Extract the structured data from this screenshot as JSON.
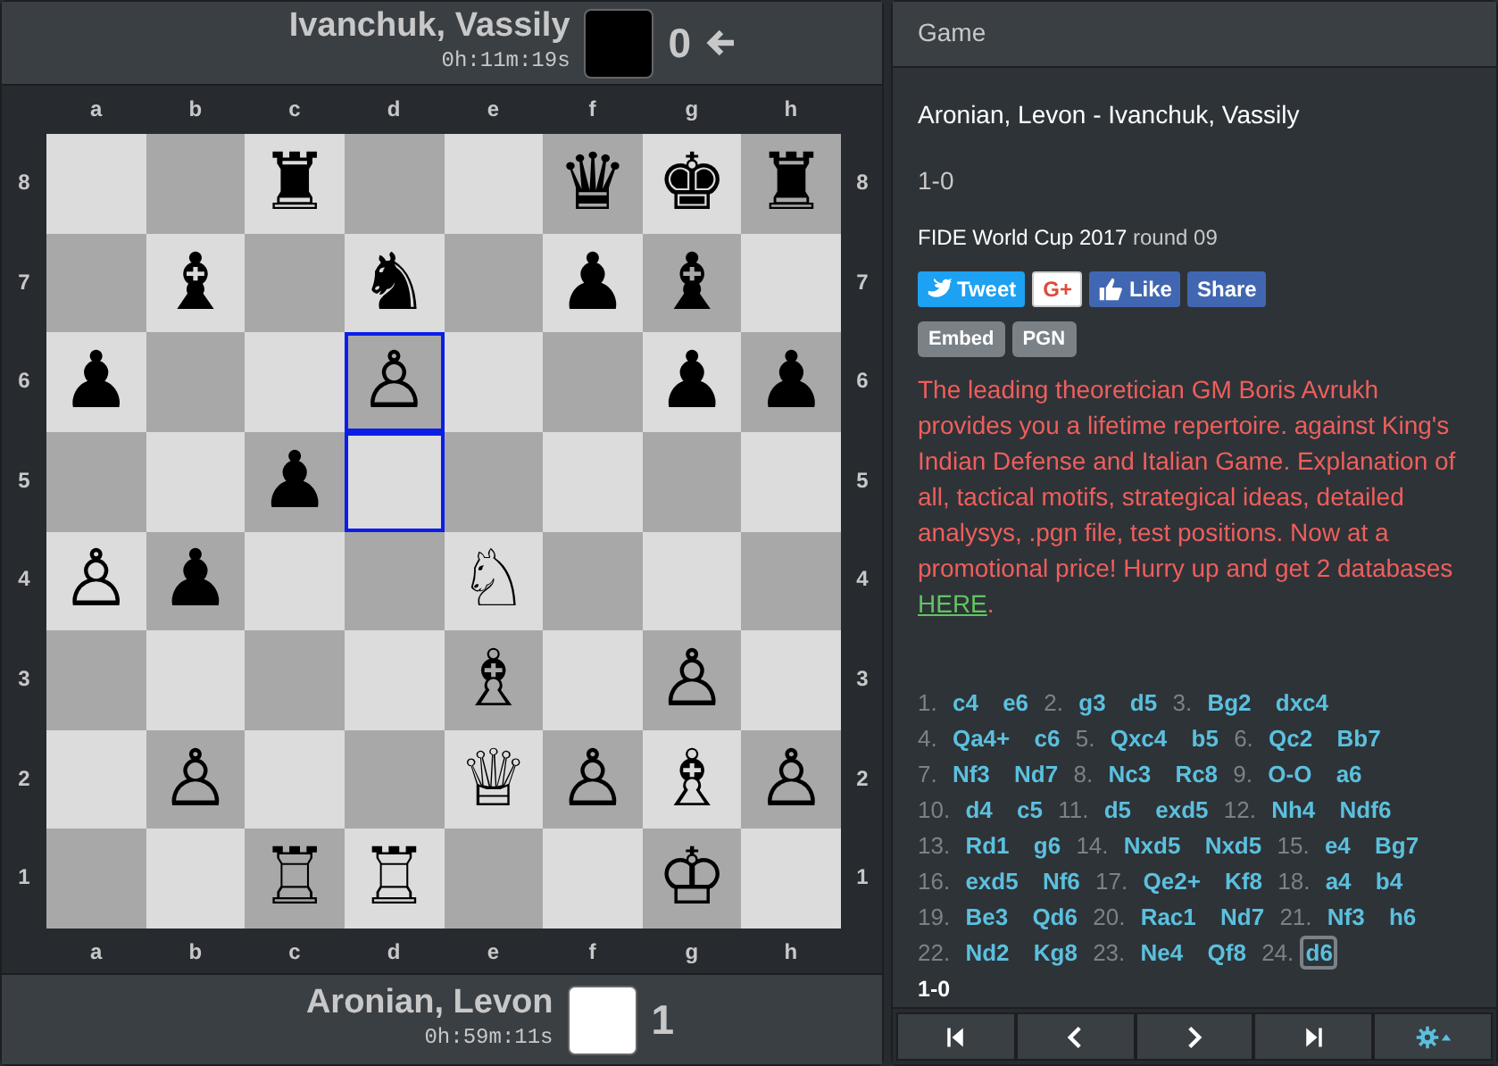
{
  "top_player": {
    "name": "Ivanchuk, Vassily",
    "clock": "0h:11m:19s",
    "color": "#000000",
    "score": "0",
    "to_move": true
  },
  "board": {
    "top_files": [
      "a",
      "b",
      "c",
      "d",
      "e",
      "f",
      "g",
      "h"
    ],
    "left_ranks": [
      "8",
      "7",
      "6",
      "5",
      "4",
      "3",
      "2",
      "1"
    ],
    "right_ranks": [
      "8",
      "7",
      "6",
      "5",
      "4",
      "3",
      "2",
      "1"
    ],
    "ranks": [
      {
        "squares": [
          {
            "highlighted": false
          },
          {
            "highlighted": false
          },
          {
            "piece": "♜",
            "highlighted": false
          },
          {
            "highlighted": false
          },
          {
            "highlighted": false
          },
          {
            "piece": "♛",
            "highlighted": false
          },
          {
            "piece": "♚",
            "highlighted": false
          },
          {
            "piece": "♜",
            "highlighted": false
          }
        ]
      },
      {
        "squares": [
          {
            "highlighted": false
          },
          {
            "piece": "♝",
            "highlighted": false
          },
          {
            "highlighted": false
          },
          {
            "piece": "♞",
            "highlighted": false
          },
          {
            "highlighted": false
          },
          {
            "piece": "♟",
            "highlighted": false
          },
          {
            "piece": "♝",
            "highlighted": false
          },
          {
            "highlighted": false
          }
        ]
      },
      {
        "squares": [
          {
            "piece": "♟",
            "highlighted": false
          },
          {
            "highlighted": false
          },
          {
            "highlighted": false
          },
          {
            "piece": "♙",
            "highlighted": true
          },
          {
            "highlighted": false
          },
          {
            "highlighted": false
          },
          {
            "piece": "♟",
            "highlighted": false
          },
          {
            "piece": "♟",
            "highlighted": false
          }
        ]
      },
      {
        "squares": [
          {
            "highlighted": false
          },
          {
            "highlighted": false
          },
          {
            "piece": "♟",
            "highlighted": false
          },
          {
            "highlighted": true
          },
          {
            "highlighted": false
          },
          {
            "highlighted": false
          },
          {
            "highlighted": false
          },
          {
            "highlighted": false
          }
        ]
      },
      {
        "squares": [
          {
            "piece": "♙",
            "highlighted": false
          },
          {
            "piece": "♟",
            "highlighted": false
          },
          {
            "highlighted": false
          },
          {
            "highlighted": false
          },
          {
            "piece": "♘",
            "highlighted": false
          },
          {
            "highlighted": false
          },
          {
            "highlighted": false
          },
          {
            "highlighted": false
          }
        ]
      },
      {
        "squares": [
          {
            "highlighted": false
          },
          {
            "highlighted": false
          },
          {
            "highlighted": false
          },
          {
            "highlighted": false
          },
          {
            "piece": "♗",
            "highlighted": false
          },
          {
            "highlighted": false
          },
          {
            "piece": "♙",
            "highlighted": false
          },
          {
            "highlighted": false
          }
        ]
      },
      {
        "squares": [
          {
            "highlighted": false
          },
          {
            "piece": "♙",
            "highlighted": false
          },
          {
            "highlighted": false
          },
          {
            "highlighted": false
          },
          {
            "piece": "♕",
            "highlighted": false
          },
          {
            "piece": "♙",
            "highlighted": false
          },
          {
            "piece": "♗",
            "highlighted": false
          },
          {
            "piece": "♙",
            "highlighted": false
          }
        ]
      },
      {
        "squares": [
          {
            "highlighted": false
          },
          {
            "highlighted": false
          },
          {
            "piece": "♖",
            "highlighted": false
          },
          {
            "piece": "♖",
            "highlighted": false
          },
          {
            "highlighted": false
          },
          {
            "highlighted": false
          },
          {
            "piece": "♔",
            "highlighted": false
          },
          {
            "highlighted": false
          }
        ]
      }
    ],
    "bottom_files": [
      "a",
      "b",
      "c",
      "d",
      "e",
      "f",
      "g",
      "h"
    ]
  },
  "bottom_player": {
    "name": "Aronian, Levon",
    "clock": "0h:59m:11s",
    "color": "#ffffff",
    "score": "1",
    "to_move": false
  },
  "panel": {
    "title": "Game",
    "game_title": "Aronian, Levon - Ivanchuk, Vassily",
    "result": "1-0",
    "event": "FIDE World Cup 2017",
    "round": "round 09",
    "share_buttons": [
      {
        "kind": "tweet",
        "label": "Tweet"
      },
      {
        "kind": "gplus",
        "label": "G+"
      },
      {
        "kind": "like",
        "label": "Like"
      },
      {
        "kind": "share",
        "label": "Share"
      }
    ],
    "tags": [
      "Embed",
      "PGN"
    ],
    "promo": "The leading theoretician GM Boris Avrukh provides you a lifetime repertoire. against King's Indian Defense and Italian Game. Explanation of all, tactical motifs, strategical ideas, detailed analysys, .pgn file, test positions. Now at a promotional price! Hurry up and get 2 databases",
    "promo_link": "HERE",
    "promo_end": ".",
    "moves": [
      {
        "number": "1.",
        "white": "c4",
        "black": "e6",
        "selected": false
      },
      {
        "number": "2.",
        "white": "g3",
        "black": "d5",
        "selected": false
      },
      {
        "number": "3.",
        "white": "Bg2",
        "black": "dxc4",
        "selected": false
      },
      {
        "number": "4.",
        "white": "Qa4+",
        "black": "c6",
        "selected": false
      },
      {
        "number": "5.",
        "white": "Qxc4",
        "black": "b5",
        "selected": false
      },
      {
        "number": "6.",
        "white": "Qc2",
        "black": "Bb7",
        "selected": false
      },
      {
        "number": "7.",
        "white": "Nf3",
        "black": "Nd7",
        "selected": false
      },
      {
        "number": "8.",
        "white": "Nc3",
        "black": "Rc8",
        "selected": false
      },
      {
        "number": "9.",
        "white": "O-O",
        "black": "a6",
        "selected": false
      },
      {
        "number": "10.",
        "white": "d4",
        "black": "c5",
        "selected": false
      },
      {
        "number": "11.",
        "white": "d5",
        "black": "exd5",
        "selected": false
      },
      {
        "number": "12.",
        "white": "Nh4",
        "black": "Ndf6",
        "selected": false
      },
      {
        "number": "13.",
        "white": "Rd1",
        "black": "g6",
        "selected": false
      },
      {
        "number": "14.",
        "white": "Nxd5",
        "black": "Nxd5",
        "selected": false
      },
      {
        "number": "15.",
        "white": "e4",
        "black": "Bg7",
        "selected": false
      },
      {
        "number": "16.",
        "white": "exd5",
        "black": "Nf6",
        "selected": false
      },
      {
        "number": "17.",
        "white": "Qe2+",
        "black": "Kf8",
        "selected": false
      },
      {
        "number": "18.",
        "white": "a4",
        "black": "b4",
        "selected": false
      },
      {
        "number": "19.",
        "white": "Be3",
        "black": "Qd6",
        "selected": false
      },
      {
        "number": "20.",
        "white": "Rac1",
        "black": "Nd7",
        "selected": false
      },
      {
        "number": "21.",
        "white": "Nf3",
        "black": "h6",
        "selected": false
      },
      {
        "number": "22.",
        "white": "Nd2",
        "black": "Kg8",
        "selected": false
      },
      {
        "number": "23.",
        "white": "Ne4",
        "black": "Qf8",
        "selected": false
      },
      {
        "number": "24.",
        "white": "d6",
        "selected": true
      }
    ],
    "final_result": "1-0"
  },
  "nav_buttons": [
    {
      "kind": "first"
    },
    {
      "kind": "prev"
    },
    {
      "kind": "next"
    },
    {
      "kind": "last"
    },
    {
      "kind": "settings"
    }
  ]
}
